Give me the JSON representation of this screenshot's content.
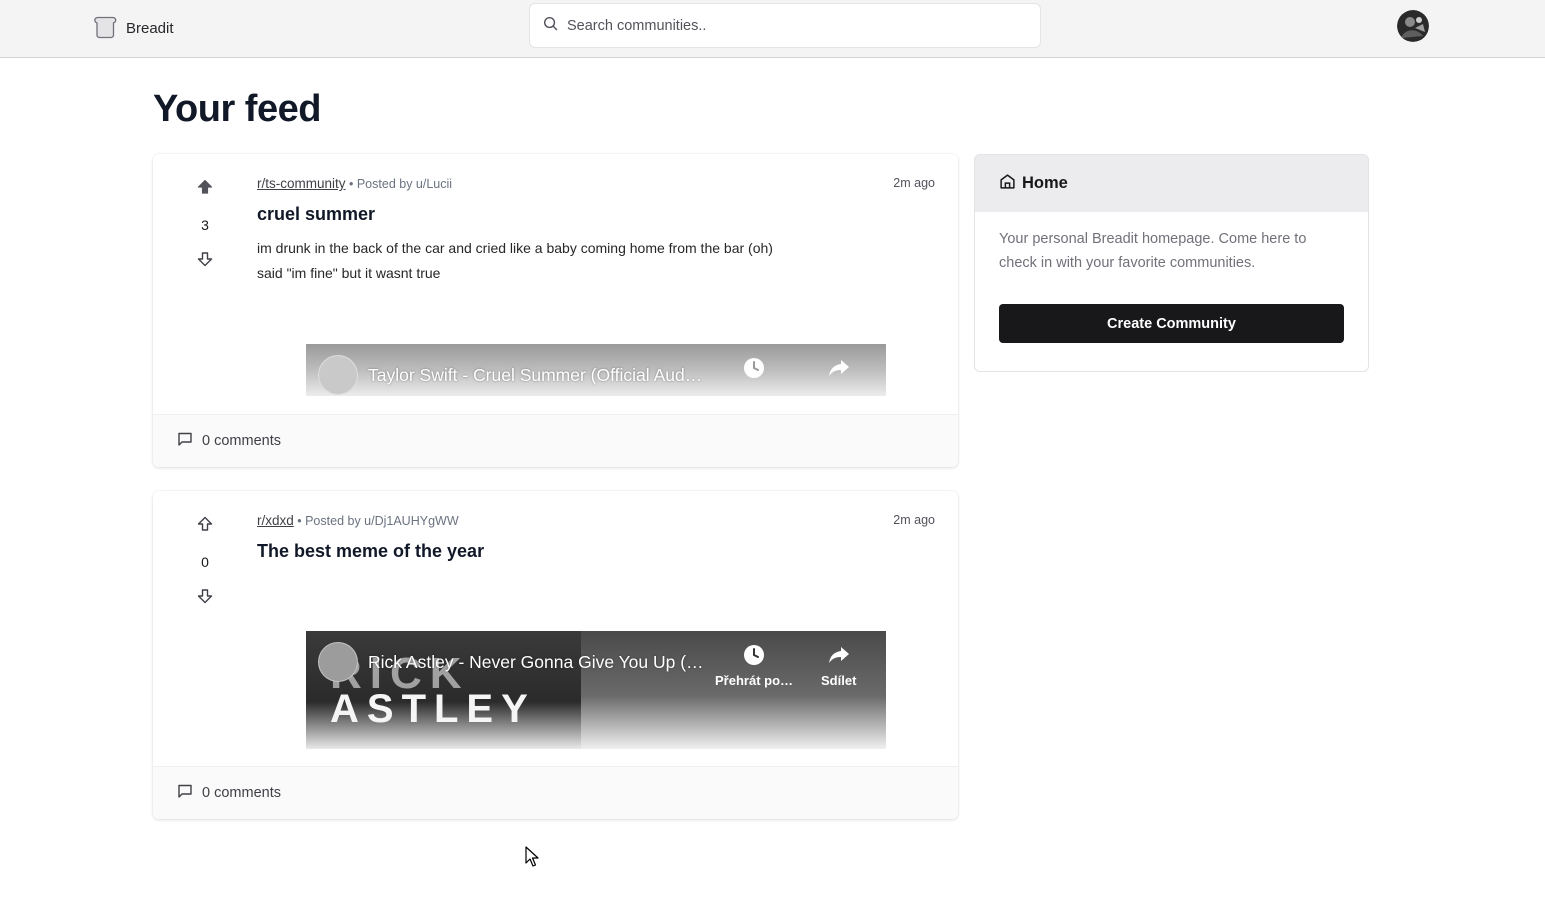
{
  "app": {
    "name": "Breadit",
    "search_placeholder": "Search communities.."
  },
  "feed": {
    "title": "Your feed"
  },
  "posts": [
    {
      "subreddit": "r/ts-community",
      "posted_by": "• Posted by u/Lucii",
      "time": "2m ago",
      "votes": "3",
      "upvoted": true,
      "title": "cruel summer",
      "body_lines": [
        "im drunk in the back of the car and cried like a baby coming home from the bar (oh)",
        "said \"im fine\" but it wasnt true"
      ],
      "video_title": "Taylor Swift - Cruel Summer (Official Aud…",
      "comments": "0 comments"
    },
    {
      "subreddit": "r/xdxd",
      "posted_by": "• Posted by u/Dj1AUHYgWW",
      "time": "2m ago",
      "votes": "0",
      "upvoted": false,
      "title": "The best meme of the year",
      "video_title": "Rick Astley - Never Gonna Give You Up (…",
      "video_watch_later": "Přehrát po…",
      "video_share": "Sdílet",
      "thumbnail_text_1": "RICK",
      "thumbnail_text_2": "ASTLEY",
      "comments": "0 comments"
    }
  ],
  "sidebar": {
    "title": "Home",
    "description": "Your personal Breadit homepage. Come here to check in with your favorite communities.",
    "create_label": "Create Community"
  },
  "colors": {
    "navbar_bg": "#f4f4f5",
    "primary_button": "#18181b",
    "sidebar_header": "#ececee"
  },
  "icons": [
    "bread-icon",
    "search-icon",
    "arrow-big-up-icon",
    "arrow-big-down-icon",
    "message-square-icon",
    "home-icon",
    "clock-icon",
    "share-icon"
  ]
}
